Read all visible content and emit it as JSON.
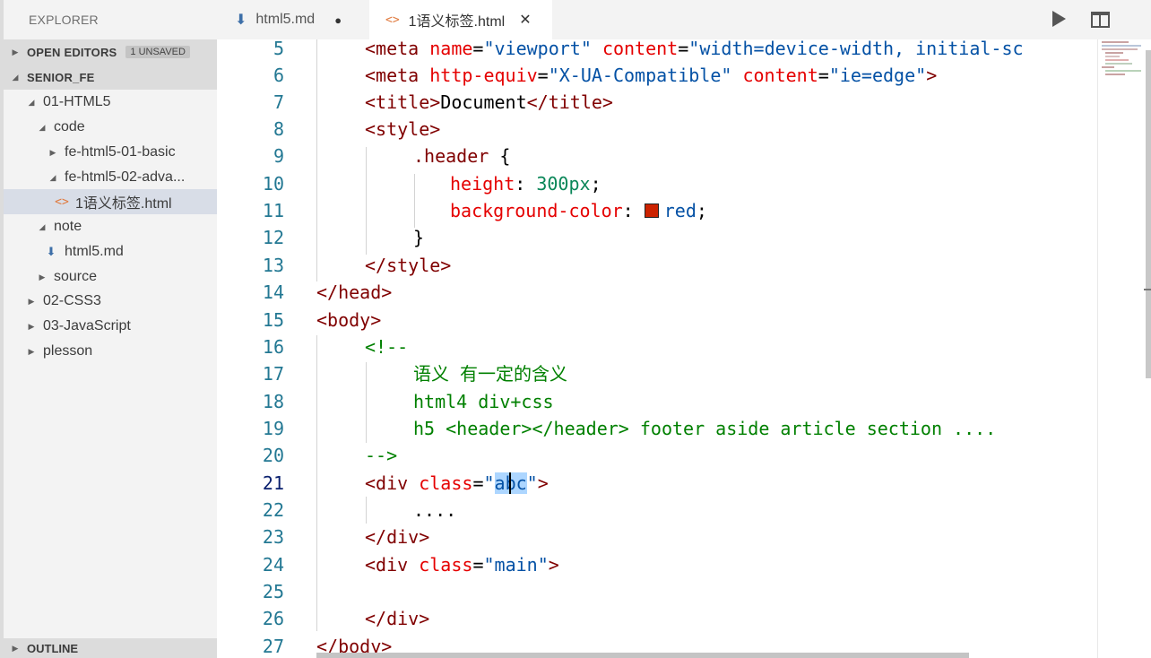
{
  "sidebar": {
    "title": "EXPLORER",
    "open_editors": {
      "label": "OPEN EDITORS",
      "badge": "1 UNSAVED"
    },
    "root": {
      "label": "SENIOR_FE"
    },
    "tree": [
      {
        "label": "01-HTML5",
        "expanded": true
      },
      {
        "label": "code",
        "expanded": true
      },
      {
        "label": "fe-html5-01-basic",
        "expanded": false
      },
      {
        "label": "fe-html5-02-adva...",
        "expanded": true
      },
      {
        "label": "1语义标签.html",
        "icon": "html-file-icon",
        "selected": true
      },
      {
        "label": "note",
        "expanded": true
      },
      {
        "label": "html5.md",
        "icon": "markdown-file-icon"
      },
      {
        "label": "source",
        "expanded": false
      },
      {
        "label": "02-CSS3",
        "expanded": false
      },
      {
        "label": "03-JavaScript",
        "expanded": false
      },
      {
        "label": "plesson",
        "expanded": false
      }
    ],
    "outline": {
      "label": "OUTLINE"
    }
  },
  "tabs": [
    {
      "label": "html5.md",
      "icon": "markdown-file-icon",
      "dirty": true,
      "active": false
    },
    {
      "label": "1语义标签.html",
      "icon": "html-file-icon",
      "active": true,
      "close": "✕"
    }
  ],
  "editor": {
    "current_line": 21,
    "lines": [
      {
        "n": "5"
      },
      {
        "n": "6"
      },
      {
        "n": "7"
      },
      {
        "n": "8"
      },
      {
        "n": "9"
      },
      {
        "n": "10"
      },
      {
        "n": "11"
      },
      {
        "n": "12"
      },
      {
        "n": "13"
      },
      {
        "n": "14"
      },
      {
        "n": "15"
      },
      {
        "n": "16"
      },
      {
        "n": "17"
      },
      {
        "n": "18"
      },
      {
        "n": "19"
      },
      {
        "n": "20"
      },
      {
        "n": "21"
      },
      {
        "n": "22"
      },
      {
        "n": "23"
      },
      {
        "n": "24"
      },
      {
        "n": "25"
      },
      {
        "n": "26"
      },
      {
        "n": "27"
      }
    ],
    "code": {
      "l5": {
        "open": "<meta ",
        "a1": "name",
        "eq1": "=",
        "v1": "\"viewport\"",
        "a2": "content",
        "eq2": "=",
        "v2": "\"width=device-width, initial-sc"
      },
      "l6": {
        "open": "<meta ",
        "a1": "http-equiv",
        "eq1": "=",
        "v1": "\"X-UA-Compatible\"",
        "a2": "content",
        "eq2": "=",
        "v2": "\"ie=edge\"",
        "close": ">"
      },
      "l7": {
        "t1": "<title>",
        "text": "Document",
        "t2": "</title>"
      },
      "l8": {
        "t1": "<style>"
      },
      "l9": {
        "selector": ".header",
        "brace": " {"
      },
      "l10": {
        "prop": "height",
        "colon": ": ",
        "val": "300px",
        "semi": ";"
      },
      "l11": {
        "prop": "background-color",
        "colon": ": ",
        "val": "red",
        "semi": ";"
      },
      "l12": {
        "brace": "}"
      },
      "l13": {
        "t1": "</style>"
      },
      "l14": {
        "t1": "</head>"
      },
      "l15": {
        "t1": "<body>"
      },
      "l16": {
        "c": "<!--"
      },
      "l17": {
        "c": "语义 有一定的含义"
      },
      "l18": {
        "c": "html4 div+css"
      },
      "l19": {
        "c": "h5 <header></header> footer aside article section ...."
      },
      "l20": {
        "c": "-->"
      },
      "l21": {
        "open": "<div ",
        "a1": "class",
        "eq1": "=",
        "q1": "\"",
        "sel": "abc",
        "q2": "\"",
        "close": ">"
      },
      "l22": {
        "text": "...."
      },
      "l23": {
        "t1": "</div>"
      },
      "l24": {
        "open": "<div ",
        "a1": "class",
        "eq1": "=",
        "v1": "\"main\"",
        "close": ">"
      },
      "l25": {
        "text": ""
      },
      "l26": {
        "t1": "</div>"
      },
      "l27": {
        "t1": "</body>"
      }
    }
  },
  "colors": {
    "tag": "#800000",
    "attribute": "#e50000",
    "string": "#0451a5",
    "comment": "#008000",
    "number": "#098658",
    "line_number": "#237893",
    "selection": "#add6ff",
    "swatch_red": "#cc2200"
  },
  "icons": {
    "run": "play-icon",
    "split": "split-editor-icon"
  }
}
